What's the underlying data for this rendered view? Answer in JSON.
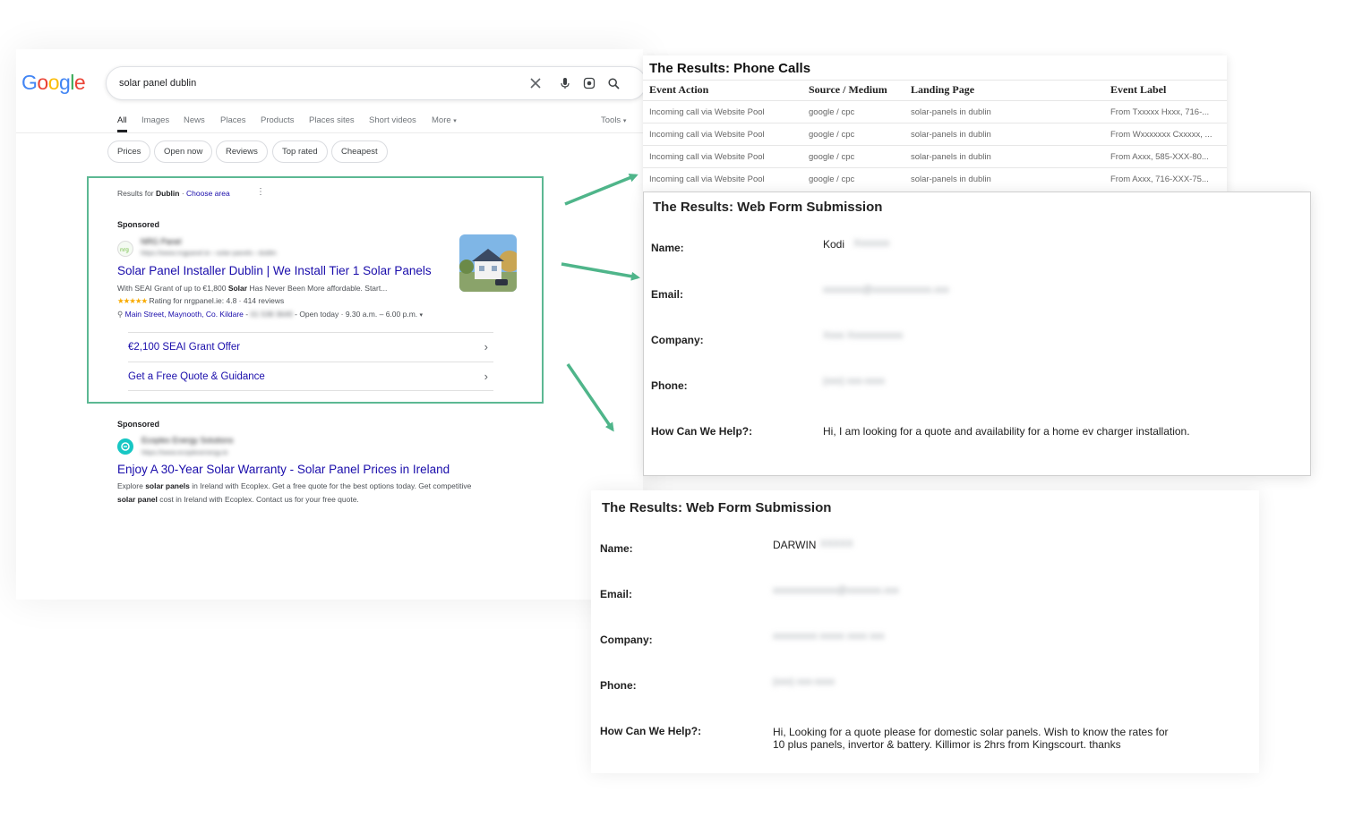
{
  "serp": {
    "search_query": "solar panel dublin",
    "tabs": [
      "All",
      "Images",
      "News",
      "Places",
      "Products",
      "Places sites",
      "Short videos",
      "More"
    ],
    "tools_label": "Tools",
    "chips": [
      "Prices",
      "Open now",
      "Reviews",
      "Top rated",
      "Cheapest"
    ],
    "results_for_prefix": "Results for",
    "results_for_location": "Dublin",
    "choose_area": "Choose area",
    "ad1": {
      "sponsored": "Sponsored",
      "advertiser": "NRG Panel",
      "url": "https://www.nrgpanel.ie › solar-panels › dublin",
      "title": "Solar Panel Installer Dublin | We Install Tier 1 Solar Panels",
      "desc_part1": "With SEAI Grant of up to €1,800",
      "desc_bold": "Solar",
      "desc_part2": "Has Never Been More affordable. Start...",
      "stars": "★★★★★",
      "rating_text": "Rating for nrgpanel.ie: 4.8 · 414 reviews",
      "address": "Main Street, Maynooth, Co. Kildare",
      "phone": "01 538 3649",
      "hours": "Open today · 9.30 a.m. – 6.00 p.m.",
      "sitelinks": [
        "€2,100 SEAI Grant Offer",
        "Get a Free Quote & Guidance"
      ]
    },
    "ad2": {
      "sponsored": "Sponsored",
      "advertiser": "Ecoplex Energy Solutions",
      "url": "https://www.ecoplexenergy.ie",
      "title": "Enjoy A 30-Year Solar Warranty - Solar Panel Prices in Ireland",
      "line1_a": "Explore",
      "line1_b": "solar panels",
      "line1_c": "in Ireland with Ecoplex. Get a free quote for the best options today. Get competitive",
      "line2_a": "solar panel",
      "line2_b": "cost in Ireland with Ecoplex. Contact us for your free quote."
    }
  },
  "calls": {
    "title": "The Results: Phone Calls",
    "headers": [
      "Event Action",
      "Source / Medium",
      "Landing Page",
      "Event Label"
    ],
    "rows": [
      [
        "Incoming call via Website Pool",
        "google / cpc",
        "solar-panels in dublin",
        "From Txxxxx Hxxx, 716-..."
      ],
      [
        "Incoming call via Website Pool",
        "google / cpc",
        "solar-panels in dublin",
        "From Wxxxxxxx Cxxxxx, ..."
      ],
      [
        "Incoming call via Website Pool",
        "google / cpc",
        "solar-panels in dublin",
        "From Axxx, 585-XXX-80..."
      ],
      [
        "Incoming call via Website Pool",
        "google / cpc",
        "solar-panels in dublin",
        "From Axxx, 716-XXX-75..."
      ]
    ]
  },
  "form1": {
    "title": "The Results: Web Form Submission",
    "labels": [
      "Name:",
      "Email:",
      "Company:",
      "Phone:",
      "How Can We Help?:"
    ],
    "name": "Kodi",
    "name_blur": "Xxxxxxx",
    "email_blur": "xxxxxxxx@xxxxxxxxxxxx.xxx",
    "company_blur": "Xxxx Xxxxxxxxxxx",
    "phone_blur": "(xxx) xxx-xxxx",
    "help": "Hi, I am looking for a quote and availability for a home ev charger installation."
  },
  "form2": {
    "title": "The Results: Web Form Submission",
    "labels": [
      "Name:",
      "Email:",
      "Company:",
      "Phone:",
      "How Can We Help?:"
    ],
    "name": "DARWIN",
    "name_blur": "XXXXX",
    "email_blur": "xxxxxxxxxxxxx@xxxxxxx.xxx",
    "company_blur": "xxxxxxxxx xxxxx xxxx xxx",
    "phone_blur": "(xxx) xxx-xxxx",
    "help_line1": "Hi, Looking for a quote please for domestic solar panels. Wish to know the rates for",
    "help_line2": "10 plus panels, invertor & battery. Killimor is 2hrs from Kingscourt. thanks"
  },
  "colors": {
    "highlight": "#5cb893",
    "link": "#1a0dab",
    "arrow": "#4fb58a"
  }
}
